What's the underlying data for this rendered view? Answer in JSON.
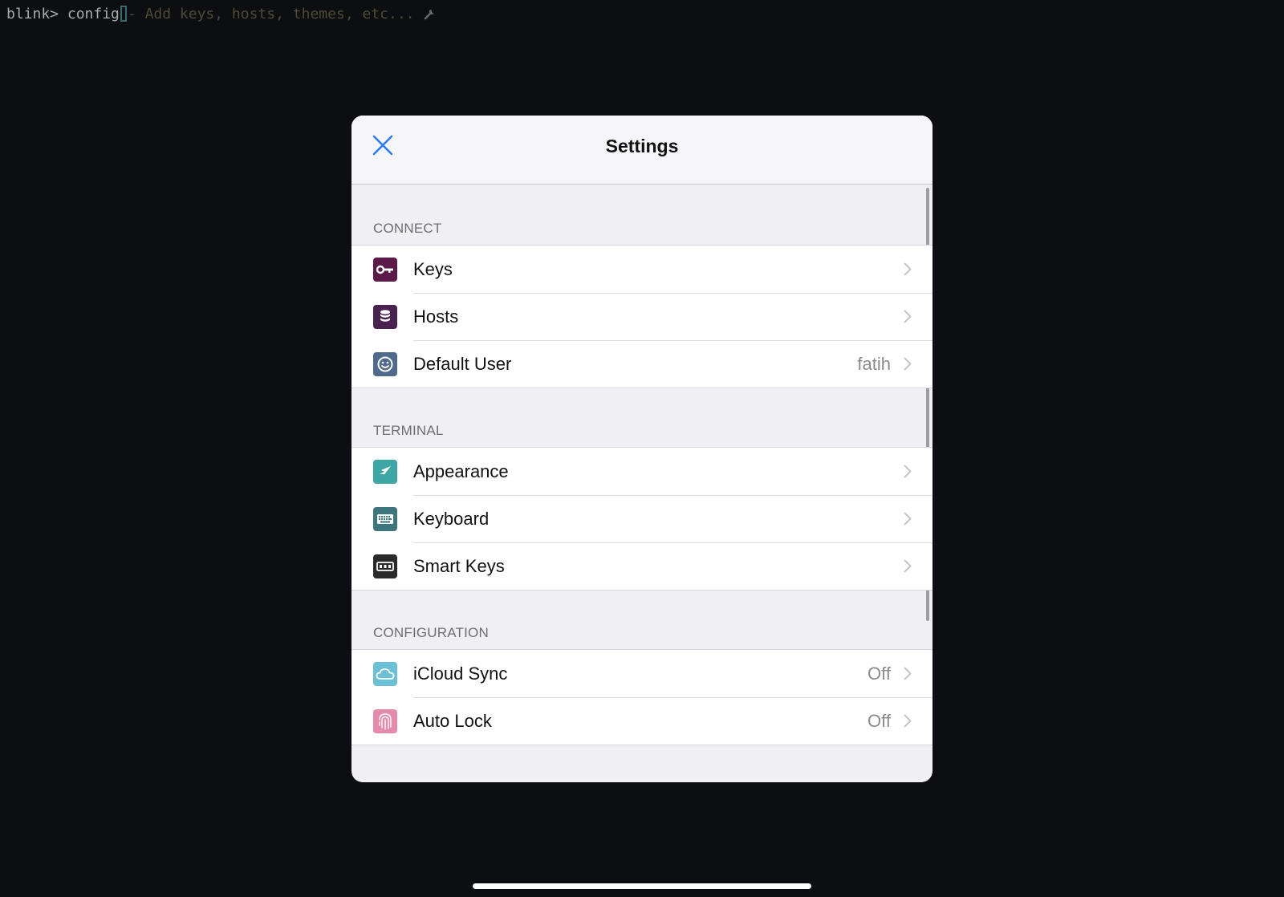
{
  "terminal": {
    "prompt": "blink>",
    "command": " config",
    "hint": "- Add keys, hosts, themes, etc...",
    "hint_icon": "wrench-icon"
  },
  "settings": {
    "title": "Settings",
    "close_icon": "close-icon",
    "sections": [
      {
        "header": "CONNECT",
        "rows": [
          {
            "label": "Keys",
            "value": "",
            "icon": "key-icon",
            "icon_color": "#5b1a4a"
          },
          {
            "label": "Hosts",
            "value": "",
            "icon": "database-icon",
            "icon_color": "#4a2250"
          },
          {
            "label": "Default User",
            "value": "fatih",
            "icon": "smiley-icon",
            "icon_color": "#4f6a8a"
          }
        ]
      },
      {
        "header": "TERMINAL",
        "rows": [
          {
            "label": "Appearance",
            "value": "",
            "icon": "brush-icon",
            "icon_color": "#3fa6a6"
          },
          {
            "label": "Keyboard",
            "value": "",
            "icon": "keyboard-icon",
            "icon_color": "#3e7680"
          },
          {
            "label": "Smart Keys",
            "value": "",
            "icon": "smart-keys-icon",
            "icon_color": "#2a2a2a"
          }
        ]
      },
      {
        "header": "CONFIGURATION",
        "rows": [
          {
            "label": "iCloud Sync",
            "value": "Off",
            "icon": "cloud-icon",
            "icon_color": "#6cc0d6"
          },
          {
            "label": "Auto Lock",
            "value": "Off",
            "icon": "fingerprint-icon",
            "icon_color": "#e48aab"
          }
        ]
      }
    ]
  },
  "colors": {
    "accent": "#2f7cf6",
    "background": "#0d0e12",
    "grouped_background": "#efeff4"
  }
}
